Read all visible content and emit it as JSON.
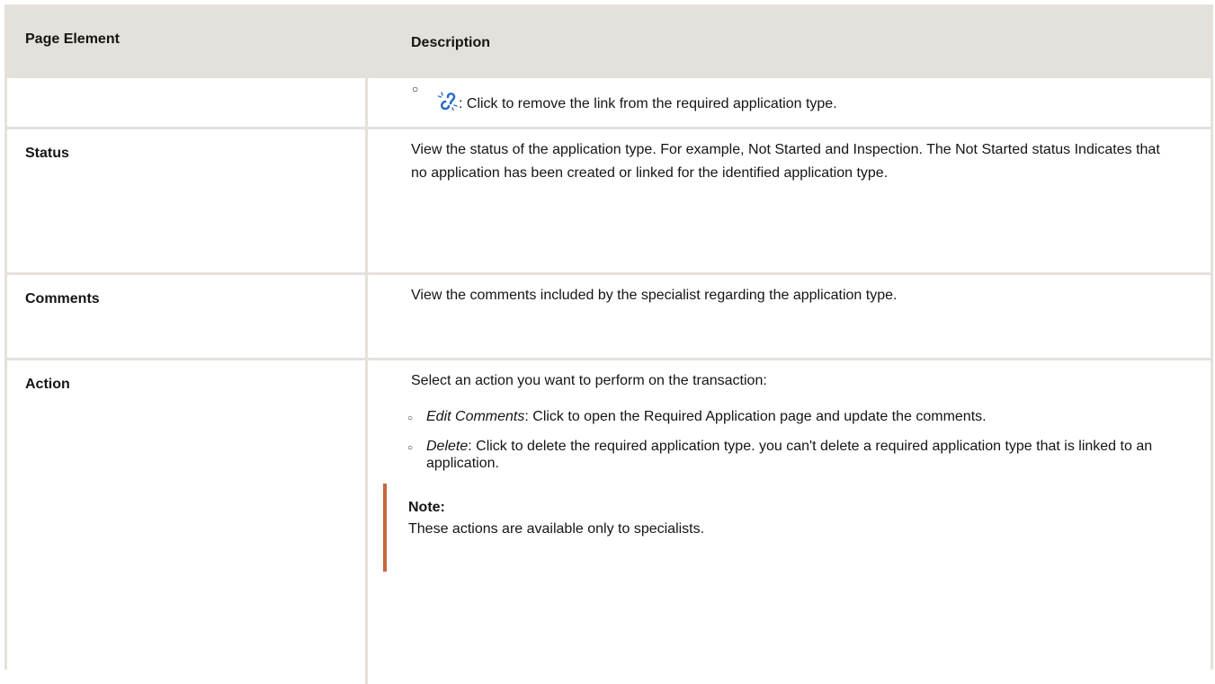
{
  "header": {
    "col1": "Page Element",
    "col2": "Description"
  },
  "rows": {
    "unlink": {
      "text": ": Click to remove the link from the required application type."
    },
    "status": {
      "label": "Status",
      "description": "View the status of the application type. For example, Not Started and Inspection. The Not Started status Indicates that no application has been created or linked for the identified application type."
    },
    "comments": {
      "label": "Comments",
      "description": "View the comments included by the specialist regarding the application type."
    },
    "action": {
      "label": "Action",
      "intro": "Select an action you want to perform on the transaction:",
      "item1_term": "Edit Comments",
      "item1_text": ": Click to open the Required Application page and update the comments.",
      "item2_term": "Delete",
      "item2_text": ": Click to delete the required application type. you can't delete a required application type that is linked to an application.",
      "note_title": "Note:",
      "note_text": "These actions are available only to specialists."
    }
  },
  "icons": {
    "unlink": "unlink-icon",
    "bullet": "hollow-bullet-icon"
  },
  "colors": {
    "border": "#e4e1dc",
    "header_bg": "#e4e1dc",
    "note_bar": "#c8663c",
    "icon_blue": "#2b6cc4",
    "bullet_green": "#4d7a3c"
  }
}
